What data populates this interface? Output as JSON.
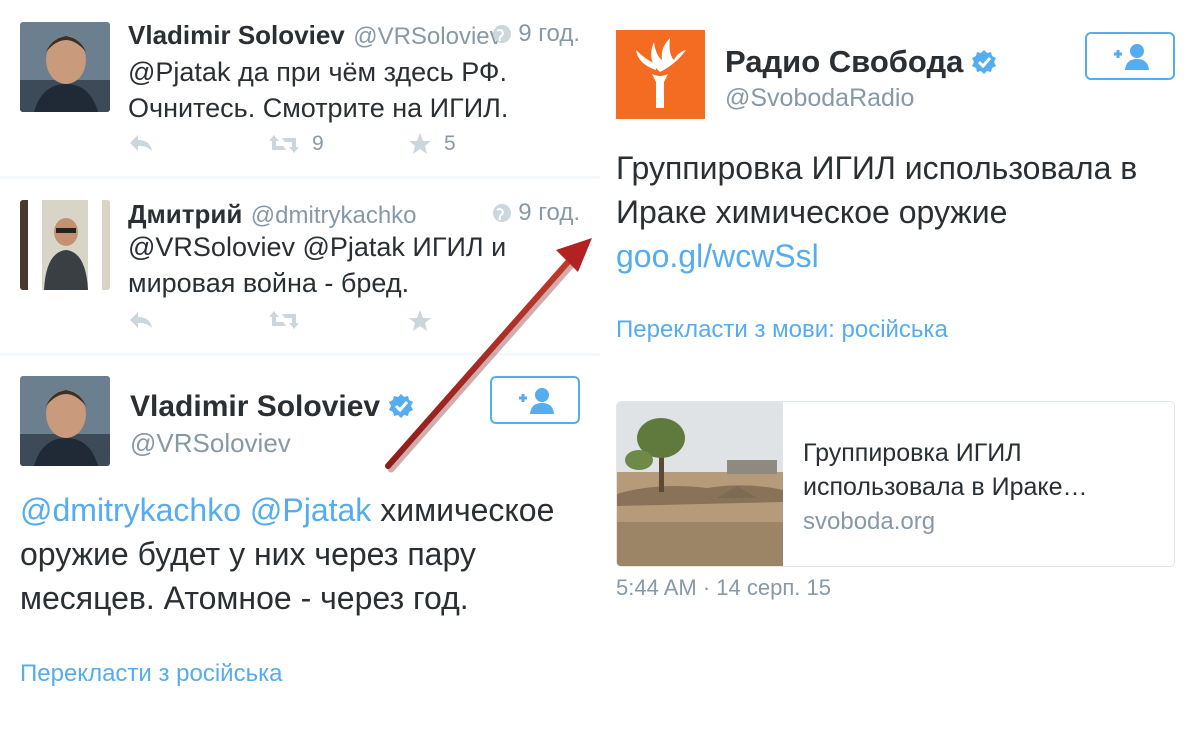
{
  "tweets": [
    {
      "name": "Vladimir Soloviev",
      "handle": "@VRSoloviev",
      "time": "9 год.",
      "text_lines": [
        "@Pjatak да при чём здесь РФ.",
        "Очнитесь. Смотрите на ИГИЛ."
      ],
      "retweets": "9",
      "favorites": "5"
    },
    {
      "name": "Дмитрий",
      "handle": "@dmitrykachko",
      "time": "9 год.",
      "text_lines": [
        "@VRSoloviev @Pjatak ИГИЛ и",
        "мировая война - бред."
      ]
    }
  ],
  "main_tweet": {
    "name": "Vladimir Soloviev",
    "handle": "@VRSoloviev",
    "mention1": "@dmitrykachko",
    "mention2": "@Pjatak",
    "text_first": " химическое",
    "text_line2": "оружие будет у них через пару",
    "text_line3": "месяцев. Атомное - через год.",
    "translate": "Перекласти з російська"
  },
  "radio_tweet": {
    "name": "Радио Свобода",
    "handle": "@SvobodaRadio",
    "text_line1": "Группировка ИГИЛ использовала в",
    "text_line2": "Ираке химическое оружие",
    "link": "goo.gl/wcwSsl",
    "translate": "Перекласти з мови: російська",
    "card_title_line1": "Группировка ИГИЛ",
    "card_title_line2": "использовала в Ираке…",
    "card_domain": "svoboda.org",
    "timestamp": "5:44 AM · 14 серп. 15"
  },
  "colors": {
    "link": "#55acee",
    "secondary": "#8899a6",
    "text": "#292f33",
    "arrow": "#b22222",
    "radio_logo": "#f36c21"
  }
}
